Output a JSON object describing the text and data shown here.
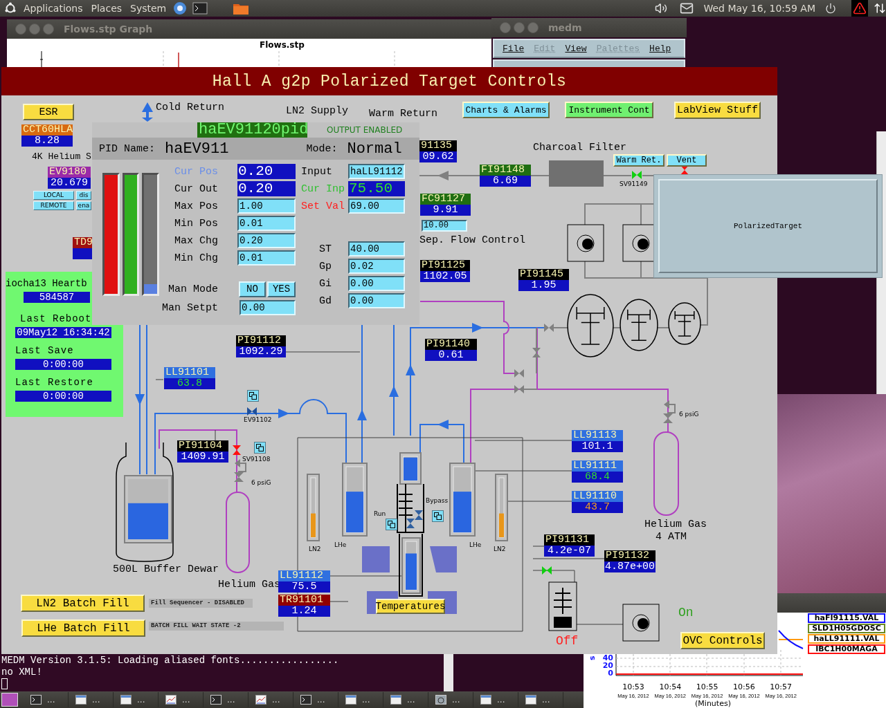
{
  "top_panel": {
    "menus": [
      "Applications",
      "Places",
      "System"
    ],
    "clock": "Wed May 16, 10:59 AM"
  },
  "graph_window": {
    "title": "Flows.stp Graph",
    "plot_title": "Flows.stp"
  },
  "medm_window": {
    "title": "medm",
    "menus": [
      {
        "label": "File",
        "disabled": false
      },
      {
        "label": "Edit",
        "disabled": true
      },
      {
        "label": "View",
        "disabled": false
      },
      {
        "label": "Palettes",
        "disabled": true
      },
      {
        "label": "Help",
        "disabled": false
      }
    ]
  },
  "control_window": {
    "title": "Hall A g2p Polarized Target Controls",
    "buttons": [
      {
        "label": "ESR",
        "color": "#f8dc40"
      },
      {
        "label": "Charts & Alarms",
        "color": "#80e0f8"
      },
      {
        "label": "Instrument Cont",
        "color": "#70f070"
      },
      {
        "label": "LabView Stuff",
        "color": "#f8dc40"
      },
      {
        "label": "Warm Ret.",
        "color": "#80e0f8"
      },
      {
        "label": "Vent",
        "color": "#80e0f8"
      },
      {
        "label": "LN2 Batch Fill",
        "color": "#f8dc40"
      },
      {
        "label": "LHe Batch Fill",
        "color": "#f8dc40"
      },
      {
        "label": "Temperatures",
        "color": "#f8dc40"
      },
      {
        "label": "OVC Controls",
        "color": "#f8dc40"
      }
    ],
    "mode_buttons": [
      "LOCAL",
      "dis",
      "REMOTE",
      "ena"
    ],
    "labels": [
      {
        "text": "Cold Return",
        "kind": "caption"
      },
      {
        "text": "LN2 Supply",
        "kind": "caption"
      },
      {
        "text": "Warm Return",
        "kind": "caption"
      },
      {
        "text": "4K Helium S",
        "kind": "caption"
      },
      {
        "text": "Charcoal Filter",
        "kind": "caption"
      },
      {
        "text": "Sep. Flow Control",
        "kind": "caption"
      },
      {
        "text": "Helium Gas",
        "kind": "caption"
      },
      {
        "text": "Helium Gas",
        "kind": "caption"
      },
      {
        "text": "4 ATM",
        "kind": "caption"
      },
      {
        "text": "SV91149",
        "kind": "tag"
      },
      {
        "text": "EV91102",
        "kind": "tag"
      },
      {
        "text": "SV91108",
        "kind": "tag"
      },
      {
        "text": "6 psiG",
        "kind": "tag"
      },
      {
        "text": "6 psiG",
        "kind": "tag"
      },
      {
        "text": "Run",
        "kind": "tag"
      },
      {
        "text": "Bypass",
        "kind": "tag"
      },
      {
        "text": "LN2",
        "kind": "tag"
      },
      {
        "text": "LHe",
        "kind": "tag"
      },
      {
        "text": "LHe",
        "kind": "tag"
      },
      {
        "text": "LN2",
        "kind": "tag"
      },
      {
        "text": "Off",
        "kind": "caption",
        "color": "#ff2020"
      },
      {
        "text": "On",
        "kind": "caption",
        "color": "#30a020"
      }
    ],
    "readouts": [
      {
        "name": "CCT60HLA",
        "value": "8.28",
        "color": "#d86a10",
        "kind": "plain"
      },
      {
        "name": "EV9180",
        "value": "20.679",
        "color": "#9a2aa8",
        "kind": "plain"
      },
      {
        "name": "TD9",
        "color": "#a01010",
        "kind": "plain"
      },
      {
        "name": "91135",
        "value": "09.62",
        "color": "#000000",
        "kind": "plain"
      },
      {
        "name": "FI91148",
        "value": "6.69",
        "color": "#1f6e12",
        "kind": "plain"
      },
      {
        "name": "FC91127",
        "value": "9.91",
        "color": "#1f6e12",
        "kind": "plain"
      },
      {
        "name": "PI91125",
        "value": "1102.05",
        "color": "#000000",
        "kind": "plain"
      },
      {
        "name": "PI91145",
        "value": "1.95",
        "color": "#000000",
        "kind": "plain"
      },
      {
        "name": "PI91112",
        "value": "1092.29",
        "color": "#000000",
        "kind": "plain"
      },
      {
        "name": "PI91140",
        "value": "0.61",
        "color": "#000000",
        "kind": "plain"
      },
      {
        "name": "LL91101",
        "value": "63.8",
        "color": "#3070e0",
        "kind": "ok"
      },
      {
        "name": "PI91104",
        "value": "1409.91",
        "color": "#000000",
        "kind": "plain"
      },
      {
        "name": "LL91113",
        "value": "101.1",
        "color": "#3070e0",
        "kind": "plain"
      },
      {
        "name": "LL91111",
        "value": "68.4",
        "color": "#3070e0",
        "kind": "ok"
      },
      {
        "name": "LL91110",
        "value": "43.7",
        "color": "#3070e0",
        "kind": "minor"
      },
      {
        "name": "PI91131",
        "value": "4.2e-07",
        "color": "#000000",
        "kind": "plain"
      },
      {
        "name": "PI91132",
        "value": "4.87e+00",
        "color": "#000000",
        "kind": "plain"
      },
      {
        "name": "LL91112",
        "value": "75.5",
        "color": "#3070e0",
        "kind": "plain"
      },
      {
        "name": "TR91101",
        "value": "1.24",
        "color": "#900000",
        "kind": "plain"
      }
    ],
    "setpoint": {
      "value": "10.00"
    },
    "heartbeat": {
      "title": "iocha13 Heartb",
      "count": "584587",
      "fields": [
        {
          "label": "Last Reboot",
          "value": "09May12 16:34:42"
        },
        {
          "label": "Last Save",
          "value": "0:00:00"
        },
        {
          "label": "Last Restore",
          "value": "0:00:00"
        }
      ]
    },
    "status_texts": [
      "Fill Sequencer - DISABLED",
      "BATCH FILL WAIT STATE -2"
    ],
    "dewar": {
      "label": "500L Buffer Dewar",
      "level": 0.6
    },
    "vessels": [
      {
        "level": 0.4,
        "color": "#e8961a"
      },
      {
        "level": 0.62,
        "color": "#2a66e0"
      },
      {
        "level": 0.62,
        "color": "#2a66e0"
      },
      {
        "level": 0.4,
        "color": "#e8961a"
      }
    ],
    "cryostat_gauges": [
      {
        "level": 0.95
      },
      {
        "level": 0.75
      }
    ],
    "valves": [
      {
        "color": "#ff1010"
      },
      {
        "color": "#10d010"
      },
      {
        "color": "#10d010"
      },
      {
        "color": "#ff1010"
      },
      {
        "color": "#1e4f9a"
      }
    ]
  },
  "pid_window": {
    "title": "haEV91120pid",
    "output_status": "OUTPUT ENABLED",
    "name_label": "PID Name:",
    "name": "haEV911",
    "mode_label": "Mode:",
    "mode": "Normal",
    "bars": [
      {
        "color": "#e01010",
        "level": 1
      },
      {
        "color": "#30b020",
        "level": 1
      },
      {
        "color": "#5a80e0",
        "level": 0.08
      }
    ],
    "left_fields": [
      {
        "label": {
          "text": "Cur Pos",
          "color": "#6a8ee8"
        },
        "value": "0.20",
        "kind": "readback"
      },
      {
        "label": {
          "text": "Cur Out"
        },
        "value": "0.20",
        "kind": "readback"
      },
      {
        "label": {
          "text": "Max Pos"
        },
        "value": "1.00",
        "kind": "entry"
      },
      {
        "label": {
          "text": "Min Pos"
        },
        "value": "0.01",
        "kind": "entry"
      },
      {
        "label": {
          "text": "Max Chg"
        },
        "value": "0.20",
        "kind": "entry"
      },
      {
        "label": {
          "text": "Min Chg"
        },
        "value": "0.01",
        "kind": "entry"
      }
    ],
    "man_mode": {
      "label": "Man Mode",
      "options": [
        "NO",
        "YES"
      ]
    },
    "man_setpoint": {
      "label": "Man Setpt",
      "value": "0.00"
    },
    "right_fields": [
      {
        "label": {
          "text": "Input"
        },
        "value": "haLL91112",
        "kind": "entry"
      },
      {
        "label": {
          "text": "Cur Inp",
          "color": "#30c030"
        },
        "value": "75.50",
        "kind": "monitor"
      },
      {
        "label": {
          "text": "Set Val",
          "color": "#ff2020"
        },
        "value": "69.00",
        "kind": "entry"
      }
    ],
    "tuning_fields": [
      {
        "label": "ST",
        "value": "40.00"
      },
      {
        "label": "Gp",
        "value": "0.02"
      },
      {
        "label": "Gi",
        "value": "0.00"
      },
      {
        "label": "Gd",
        "value": "0.00"
      }
    ]
  },
  "polarized_target": {
    "label": "PolarizedTarget"
  },
  "terminal": {
    "lines": [
      "MEDM Version 3.1.5: Loading aliased fonts.................",
      "no XML!"
    ]
  },
  "strip_chart": {
    "y_label": "s",
    "y_ticks": [
      "40",
      "20",
      "0"
    ],
    "x_ticks": [
      {
        "time": "10:53",
        "date": "May 16, 2012"
      },
      {
        "time": "10:54",
        "date": "May 16, 2012"
      },
      {
        "time": "10:55",
        "date": "May 16, 2012"
      },
      {
        "time": "10:56",
        "date": "May 16, 2012"
      },
      {
        "time": "10:57",
        "date": "May 16, 2012"
      }
    ],
    "x_label": "(Minutes)",
    "legend": [
      {
        "label": "haFI91115.VAL",
        "color": "#1010ff"
      },
      {
        "label": "SLD1H05GDOSC",
        "color": "#6a8a20"
      },
      {
        "label": "haLL91111.VAL",
        "color": "#ff9a10"
      },
      {
        "label": "IBC1H00MAGA",
        "color": "#ff1010"
      }
    ]
  },
  "taskbar": {
    "items": [
      {
        "kind": "terminal",
        "label": "..."
      },
      {
        "kind": "window",
        "label": "..."
      },
      {
        "kind": "window",
        "label": "..."
      },
      {
        "kind": "chart",
        "label": "..."
      },
      {
        "kind": "terminal",
        "label": "..."
      },
      {
        "kind": "chart",
        "label": "..."
      },
      {
        "kind": "terminal",
        "label": "..."
      },
      {
        "kind": "window",
        "label": "..."
      },
      {
        "kind": "window",
        "label": "..."
      },
      {
        "kind": "alarm",
        "label": "..."
      },
      {
        "kind": "window",
        "label": "..."
      },
      {
        "kind": "window",
        "label": "..."
      }
    ]
  }
}
